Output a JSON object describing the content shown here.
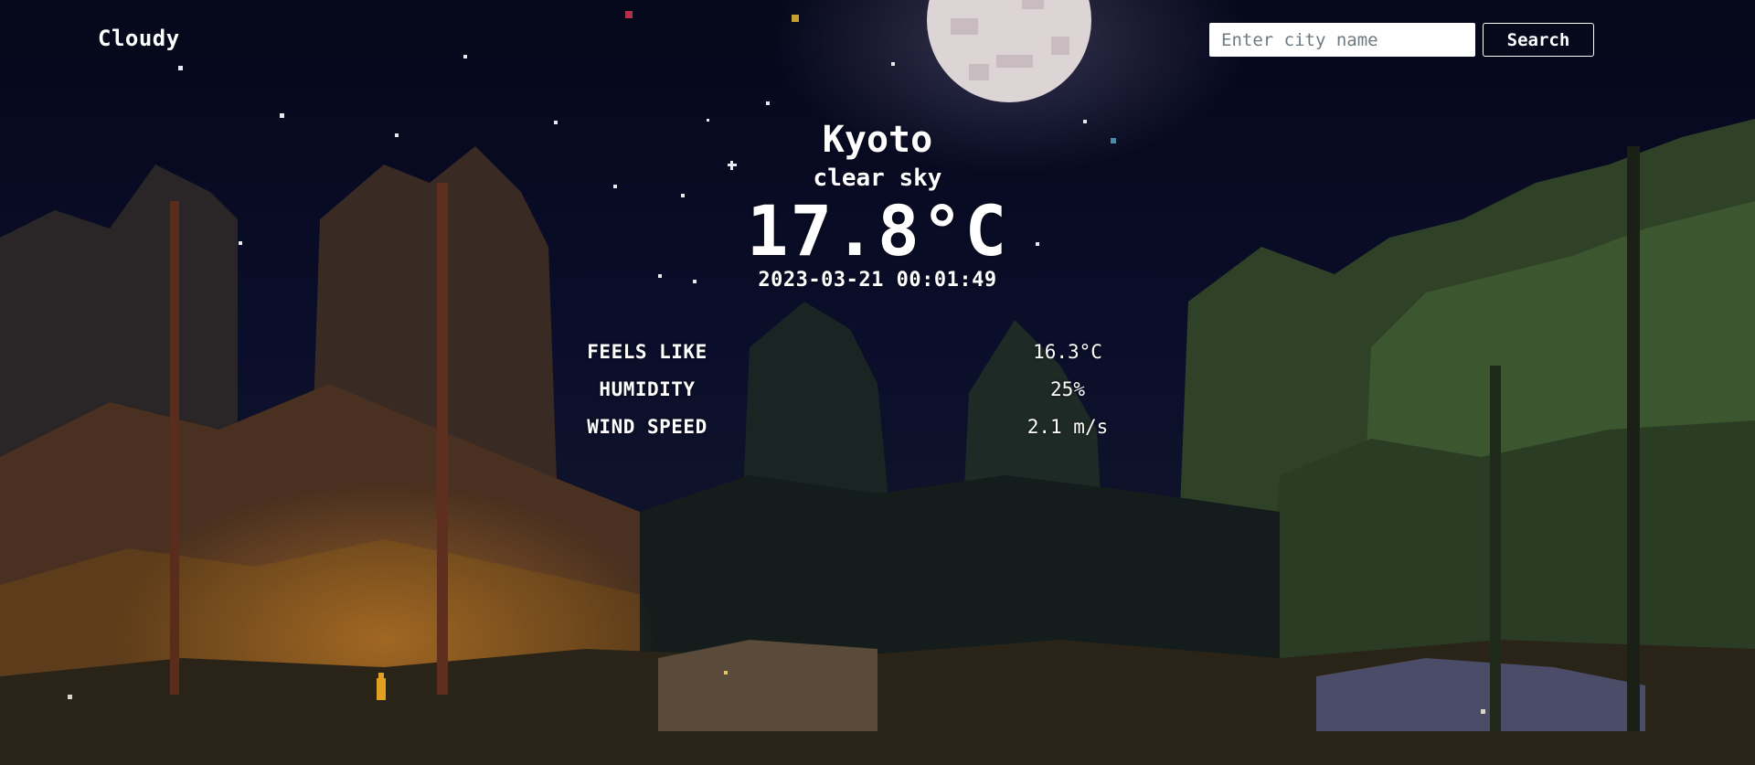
{
  "header": {
    "brand": "Cloudy",
    "search": {
      "placeholder": "Enter city name",
      "value": "",
      "button_label": "Search"
    }
  },
  "weather": {
    "city": "Kyoto",
    "description": "clear sky",
    "temperature": "17.8°C",
    "datetime": "2023-03-21 00:01:49",
    "details": [
      {
        "label": "FEELS LIKE",
        "value": "16.3°C"
      },
      {
        "label": "HUMIDITY",
        "value": "25%"
      },
      {
        "label": "WIND SPEED",
        "value": "2.1 m/s"
      }
    ]
  },
  "background": {
    "scene": "pixel-art night forest with full moon",
    "colors": {
      "sky": "#070a1c",
      "moon": "#dcd4d4",
      "autumn_trees": "#6b3a1e",
      "dark_trees": "#1c2a1e",
      "green_trees": "#3a5a2c"
    }
  }
}
